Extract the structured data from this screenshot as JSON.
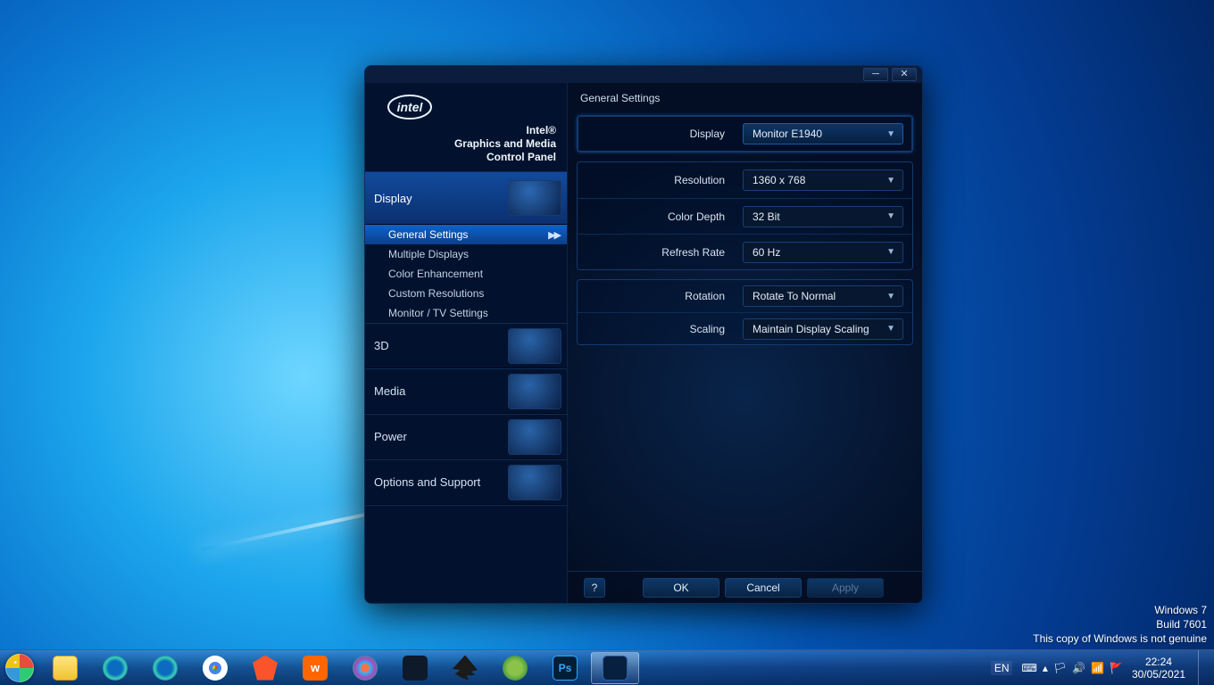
{
  "window": {
    "title1": "Intel®",
    "title2": "Graphics and Media",
    "title3": "Control Panel",
    "nav": {
      "display": "Display",
      "3d": "3D",
      "media": "Media",
      "power": "Power",
      "options": "Options and Support"
    },
    "subnav": {
      "general": "General Settings",
      "multiple": "Multiple Displays",
      "color": "Color Enhancement",
      "custom": "Custom Resolutions",
      "monitor": "Monitor / TV Settings"
    },
    "panel": {
      "header": "General Settings",
      "labels": {
        "display": "Display",
        "resolution": "Resolution",
        "colordepth": "Color Depth",
        "refresh": "Refresh Rate",
        "rotation": "Rotation",
        "scaling": "Scaling"
      },
      "values": {
        "display": "Monitor E1940",
        "resolution": "1360 x 768",
        "colordepth": "32 Bit",
        "refresh": "60 Hz",
        "rotation": "Rotate To Normal",
        "scaling": "Maintain Display Scaling"
      }
    },
    "footer": {
      "ok": "OK",
      "cancel": "Cancel",
      "apply": "Apply"
    }
  },
  "watermark": {
    "l1": "Windows 7",
    "l2": "Build 7601",
    "l3": "This copy of Windows is not genuine"
  },
  "tray": {
    "lang": "EN",
    "time": "22:24",
    "date": "30/05/2021"
  }
}
